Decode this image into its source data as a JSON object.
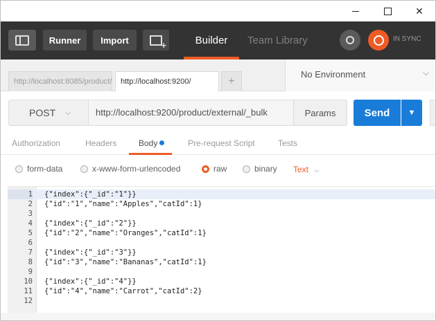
{
  "window": {
    "min_icon": "minimize-icon",
    "max_icon": "maximize-icon",
    "close_glyph": "✕"
  },
  "header": {
    "runner_label": "Runner",
    "import_label": "Import",
    "builder_label": "Builder",
    "team_library_label": "Team Library",
    "sync_label": "IN SYNC",
    "accent": "#ef5b25"
  },
  "tabs": {
    "items": [
      {
        "title": "http://localhost:8085/product/"
      },
      {
        "title": "http://localhost:9200/"
      }
    ],
    "add_glyph": "+"
  },
  "environment": {
    "selected": "No Environment",
    "chevron": "⌵"
  },
  "request": {
    "method": "POST",
    "method_chevron": "⌵",
    "url": "http://localhost:9200/product/external/_bulk",
    "params_label": "Params",
    "send_label": "Send",
    "send_menu_glyph": "▼"
  },
  "subtabs": {
    "authorization": "Authorization",
    "headers": "Headers",
    "body": "Body",
    "prerequest": "Pre-request Script",
    "tests": "Tests"
  },
  "body_types": {
    "form_data": "form-data",
    "urlencoded": "x-www-form-urlencoded",
    "raw": "raw",
    "binary": "binary",
    "selected": "raw",
    "text_mode": "Text",
    "text_mode_chevron": "⌵"
  },
  "editor": {
    "lines": [
      {
        "n": "1",
        "code": "{\"index\":{\"_id\":\"1\"}}"
      },
      {
        "n": "2",
        "code": "{\"id\":\"1\",\"name\":\"Apples\",\"catId\":1}"
      },
      {
        "n": "3",
        "code": ""
      },
      {
        "n": "4",
        "code": "{\"index\":{\"_id\":\"2\"}}"
      },
      {
        "n": "5",
        "code": "{\"id\":\"2\",\"name\":\"Oranges\",\"catId\":1}"
      },
      {
        "n": "6",
        "code": ""
      },
      {
        "n": "7",
        "code": "{\"index\":{\"_id\":\"3\"}}"
      },
      {
        "n": "8",
        "code": "{\"id\":\"3\",\"name\":\"Bananas\",\"catId\":1}"
      },
      {
        "n": "9",
        "code": ""
      },
      {
        "n": "10",
        "code": "{\"index\":{\"_id\":\"4\"}}"
      },
      {
        "n": "11",
        "code": "{\"id\":\"4\",\"name\":\"Carrot\",\"catId\":2}"
      },
      {
        "n": "12",
        "code": ""
      }
    ]
  }
}
